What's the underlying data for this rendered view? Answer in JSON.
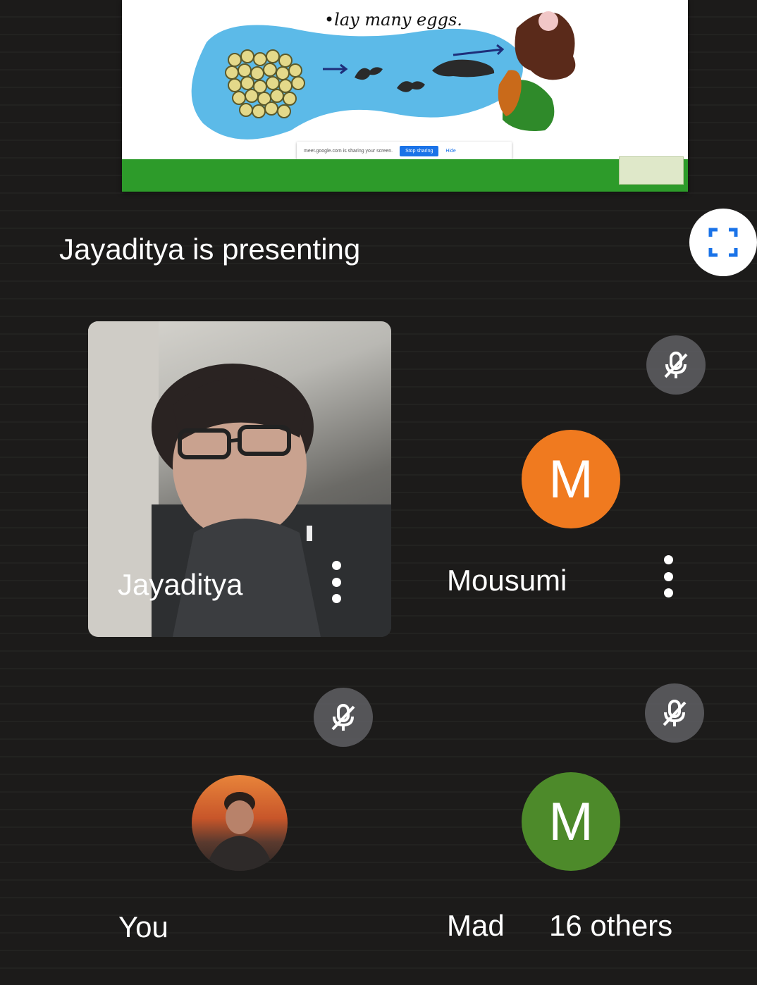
{
  "presentation": {
    "slide_caption": "•lay many eggs.",
    "share_banner_text": "meet.google.com is sharing your screen.",
    "stop_button": "Stop sharing",
    "hide_link": "Hide"
  },
  "presenting_label": "Jayaditya is presenting",
  "participants": [
    {
      "name": "Jayaditya",
      "type": "video",
      "muted": false
    },
    {
      "name": "Mousumi",
      "initial": "M",
      "avatar_color": "#f07a1f",
      "muted": true
    },
    {
      "name": "You",
      "type": "photo",
      "muted": true
    },
    {
      "name": "Mad",
      "initial": "M",
      "avatar_color": "#4d8a2a",
      "muted": true,
      "others": "16 others"
    }
  ],
  "icons": {
    "fullscreen": "fullscreen-icon",
    "mic_off": "mic-off-icon",
    "more": "more-vert-icon"
  },
  "colors": {
    "background": "#1c1b1a",
    "accent_blue": "#1a73e8",
    "orange_avatar": "#f07a1f",
    "green_avatar": "#4d8a2a"
  }
}
